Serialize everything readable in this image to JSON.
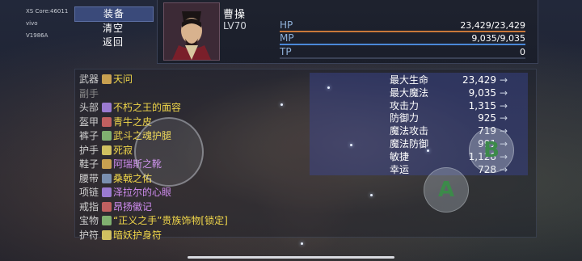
{
  "system": {
    "lines": [
      "XS Core:46011",
      "vivo",
      "V1986A"
    ]
  },
  "menu": {
    "items": [
      "装备",
      "清空",
      "返回"
    ],
    "selected_index": 0
  },
  "hero": {
    "name": "曹操",
    "level": "LV70"
  },
  "bars": [
    {
      "label": "HP",
      "value": "23,429/23,429",
      "fraction": 1.0,
      "color": "#c9783a"
    },
    {
      "label": "MP",
      "value": "9,035/9,035",
      "fraction": 1.0,
      "color": "#4a88d8"
    },
    {
      "label": "TP",
      "value": "0",
      "fraction": 0.0,
      "color": "#4a88d8"
    }
  ],
  "equipment": [
    {
      "slot": "武器",
      "item": "天问",
      "color": "yellow",
      "icon": "sword-icon"
    },
    {
      "slot": "副手",
      "item": "",
      "color": "yellow",
      "icon": ""
    },
    {
      "slot": "头部",
      "item": "不朽之王的面容",
      "color": "yellow",
      "icon": "helmet-icon"
    },
    {
      "slot": "盔甲",
      "item": "青牛之皮",
      "color": "yellow",
      "icon": "armor-icon"
    },
    {
      "slot": "裤子",
      "item": "武斗之魂护腿",
      "color": "yellow",
      "icon": "leggings-icon"
    },
    {
      "slot": "护手",
      "item": "死寂",
      "color": "yellow",
      "icon": "gauntlet-icon"
    },
    {
      "slot": "鞋子",
      "item": "阿瑞斯之靴",
      "color": "purple",
      "icon": "boots-icon"
    },
    {
      "slot": "腰带",
      "item": "桑戟之佑",
      "color": "yellow",
      "icon": "belt-icon"
    },
    {
      "slot": "项链",
      "item": "泽拉尔的心眼",
      "color": "purple",
      "icon": "necklace-icon"
    },
    {
      "slot": "戒指",
      "item": "昂扬徽记",
      "color": "purple",
      "icon": "ring-icon"
    },
    {
      "slot": "宝物",
      "item": "“正义之手”贵族饰物[锁定]",
      "color": "yellow",
      "icon": "treasure-icon"
    },
    {
      "slot": "护符",
      "item": "暗妖护身符",
      "color": "yellow",
      "icon": "amulet-icon"
    }
  ],
  "stats": [
    {
      "label": "最大生命",
      "value": "23,429",
      "arrow": "→"
    },
    {
      "label": "最大魔法",
      "value": "9,035",
      "arrow": "→"
    },
    {
      "label": "攻击力",
      "value": "1,315",
      "arrow": "→"
    },
    {
      "label": "防御力",
      "value": "925",
      "arrow": "→"
    },
    {
      "label": "魔法攻击",
      "value": "719",
      "arrow": "→"
    },
    {
      "label": "魔法防御",
      "value": "991",
      "arrow": "→"
    },
    {
      "label": "敏捷",
      "value": "1,128",
      "arrow": "→"
    },
    {
      "label": "幸运",
      "value": "728",
      "arrow": "→"
    }
  ],
  "controls": {
    "a_label": "A",
    "b_label": "B"
  },
  "colors": {
    "yellow": "#f2d84a",
    "purple": "#d08cf0",
    "white": "#f0f0f0"
  }
}
